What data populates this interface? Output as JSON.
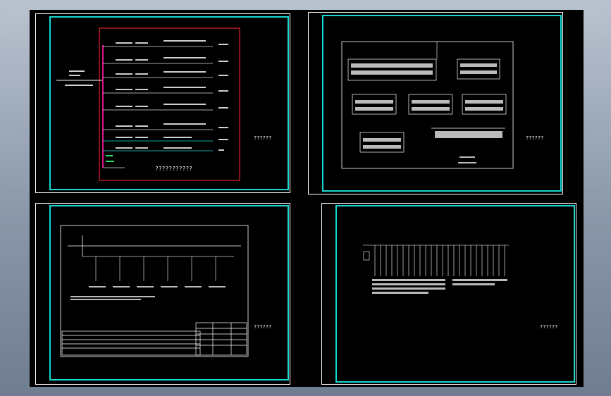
{
  "app": {
    "title": "",
    "background": "#000000",
    "frame_color": "#17d8d2"
  },
  "sheets": [
    {
      "id": "sheet-1",
      "title": "???????????",
      "caption": "??????",
      "accent": "#d8178a"
    },
    {
      "id": "sheet-2",
      "caption": "??????"
    },
    {
      "id": "sheet-3",
      "caption": "??????"
    },
    {
      "id": "sheet-4",
      "caption": "??????"
    }
  ]
}
